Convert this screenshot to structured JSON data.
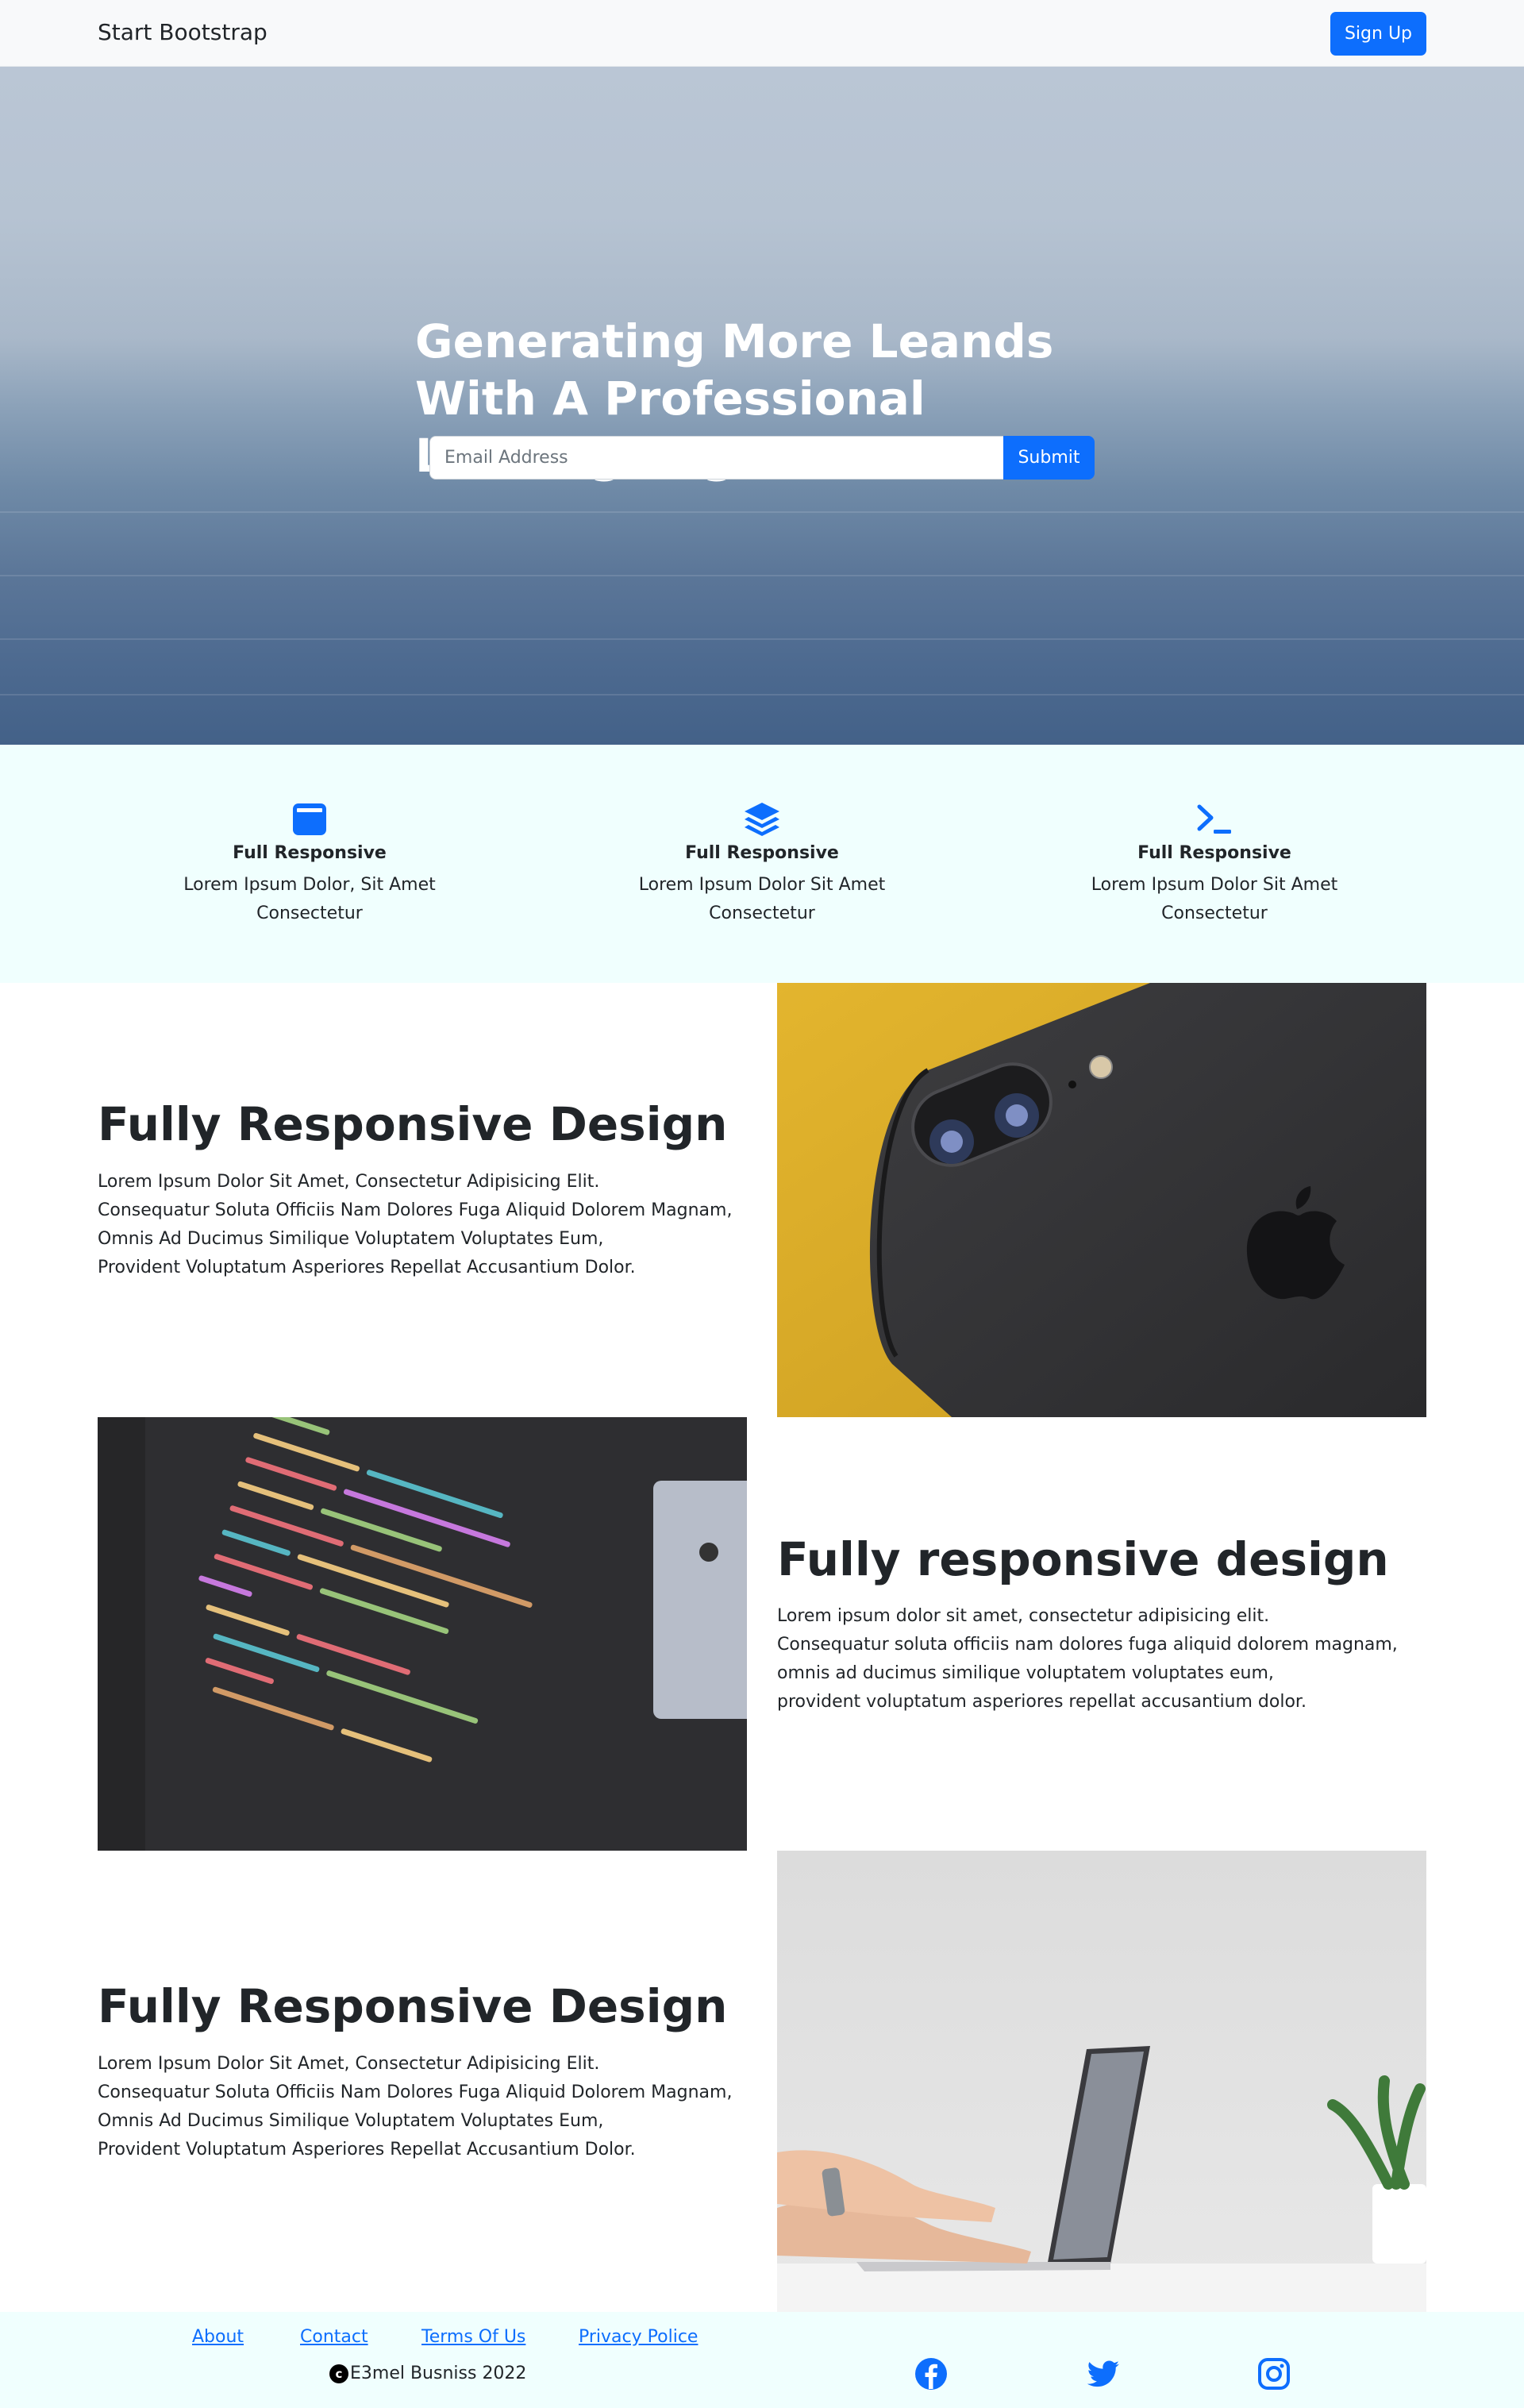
{
  "navbar": {
    "brand": "Start Bootstrap",
    "signup_label": "Sign Up"
  },
  "hero": {
    "title": "Generating More Leands With A Professional Landing Page!",
    "email_placeholder": "Email Address",
    "submit_label": "Submit"
  },
  "features": [
    {
      "icon": "window-icon",
      "title": "Full Responsive",
      "text": "Lorem Ipsum Dolor, Sit Amet Consectetur"
    },
    {
      "icon": "layers-icon",
      "title": "Full Responsive",
      "text": "Lorem Ipsum Dolor Sit Amet Consectetur"
    },
    {
      "icon": "terminal-icon",
      "title": "Full Responsive",
      "text": "Lorem Ipsum Dolor Sit Amet Consectetur"
    }
  ],
  "showcases": [
    {
      "title": "Fully Responsive Design",
      "lines": [
        "Lorem Ipsum Dolor Sit Amet, Consectetur Adipisicing Elit.",
        "Consequatur Soluta Officiis Nam Dolores Fuga Aliquid Dolorem Magnam,",
        "Omnis Ad Ducimus Similique Voluptatem Voluptates Eum,",
        "Provident Voluptatum Asperiores Repellat Accusantium Dolor."
      ],
      "image": "phone-image"
    },
    {
      "title": "Fully responsive design",
      "lines": [
        "Lorem ipsum dolor sit amet, consectetur adipisicing elit.",
        "Consequatur soluta officiis nam dolores fuga aliquid dolorem magnam,",
        "omnis ad ducimus similique voluptatem voluptates eum,",
        "provident voluptatum asperiores repellat accusantium dolor."
      ],
      "image": "code-image"
    },
    {
      "title": "Fully Responsive Design",
      "lines": [
        "Lorem Ipsum Dolor Sit Amet, Consectetur Adipisicing Elit.",
        "Consequatur Soluta Officiis Nam Dolores Fuga Aliquid Dolorem Magnam,",
        "Omnis Ad Ducimus Similique Voluptatem Voluptates Eum,",
        "Provident Voluptatum Asperiores Repellat Accusantium Dolor."
      ],
      "image": "laptop-image"
    }
  ],
  "footer": {
    "links": [
      "About",
      "Contact",
      "Terms Of Us",
      "Privacy Police"
    ],
    "copyright": "E3mel Busniss 2022",
    "social": [
      "facebook-icon",
      "twitter-icon",
      "instagram-icon"
    ]
  },
  "colors": {
    "primary": "#0d6efd",
    "feature_bg": "#f0fffe",
    "navbar_bg": "#f8f9fa"
  }
}
